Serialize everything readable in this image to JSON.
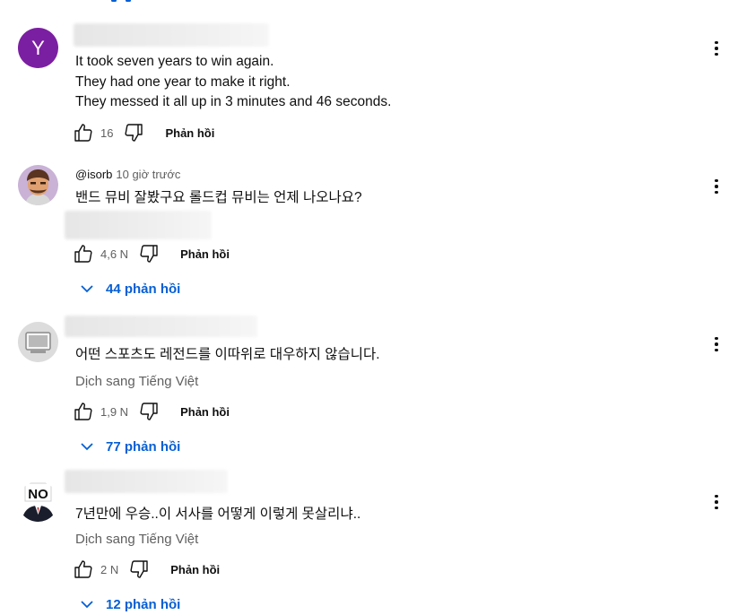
{
  "comments": [
    {
      "avatar_letter": "Y",
      "author": "",
      "time": "",
      "lines": [
        "It took seven years to win again.",
        "They had one year to make it right.",
        "They messed it all up in 3 minutes and 46 seconds."
      ],
      "likes": "16",
      "reply_label": "Phản hồi"
    },
    {
      "author": "@isorb",
      "time": "10 giờ trước",
      "lines": [
        "밴드 뮤비 잘봤구요 롤드컵 뮤비는 언제 나오나요?"
      ],
      "likes": "4,6 N",
      "reply_label": "Phản hồi",
      "replies_label": "44 phản hồi"
    },
    {
      "author": "",
      "lines": [
        "어떤 스포츠도 레전드를 이따위로 대우하지 않습니다."
      ],
      "translate_label": "Dịch sang Tiếng Việt",
      "likes": "1,9 N",
      "reply_label": "Phản hồi",
      "replies_label": "77 phản hồi"
    },
    {
      "author": "",
      "avatar_text": "NO",
      "lines": [
        "7년만에 우승..이 서사를 어떻게 이렇게 못살리냐.."
      ],
      "translate_label": "Dịch sang Tiếng Việt",
      "likes": "2 N",
      "reply_label": "Phản hồi",
      "replies_label": "12 phản hồi"
    }
  ],
  "colors": {
    "link": "#065fd4",
    "text": "#0f0f0f",
    "secondary": "#606060",
    "avatar_y": "#7b1fa2"
  },
  "icons": [
    "like-icon",
    "dislike-icon",
    "more-vert-icon",
    "chevron-down-icon"
  ]
}
